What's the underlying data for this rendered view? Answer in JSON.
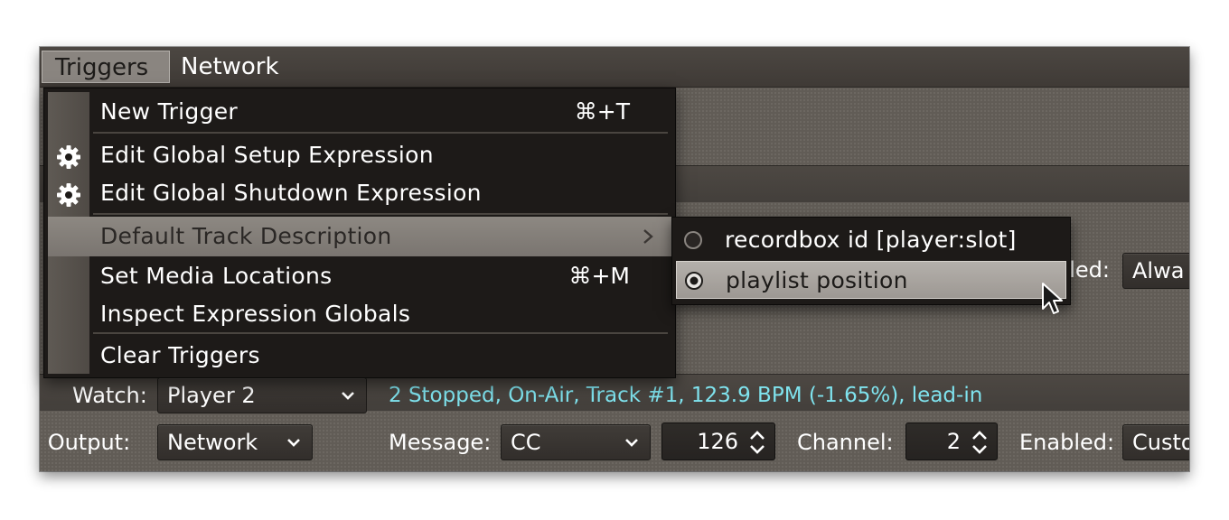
{
  "menubar": {
    "items": [
      {
        "label": "Triggers",
        "active": true
      },
      {
        "label": "Network",
        "active": false
      }
    ]
  },
  "triggers_menu": {
    "items": [
      {
        "label": "New Trigger",
        "shortcut": "⌘+T",
        "icon": ""
      },
      {
        "label": "Edit Global Setup Expression",
        "shortcut": "",
        "icon": "gear-icon"
      },
      {
        "label": "Edit Global Shutdown Expression",
        "shortcut": "",
        "icon": "gear-icon"
      },
      {
        "label": "Default Track Description",
        "shortcut": "",
        "icon": "",
        "submenu": true,
        "highlighted": true
      },
      {
        "label": "Set Media Locations",
        "shortcut": "⌘+M",
        "icon": ""
      },
      {
        "label": "Inspect Expression Globals",
        "shortcut": "",
        "icon": ""
      },
      {
        "label": "Clear Triggers",
        "shortcut": "",
        "icon": ""
      }
    ]
  },
  "default_track_submenu": {
    "items": [
      {
        "label": "recordbox id [player:slot]",
        "selected": false
      },
      {
        "label": "playlist position",
        "selected": true,
        "highlighted": true
      }
    ]
  },
  "trigger_row_partial": {
    "enabled_label_fragment": "bled:",
    "enabled_value_fragment": "Alwa"
  },
  "watch_row": {
    "watch_label": "Watch:",
    "watch_value": "Player 2",
    "status": "2 Stopped, On-Air, Track #1, 123.9 BPM (-1.65%), lead-in"
  },
  "output_row": {
    "output_label": "I Output:",
    "output_value": "Network",
    "message_label": "Message:",
    "message_value": "CC",
    "message_number": "126",
    "channel_label": "Channel:",
    "channel_value": "2",
    "enabled_label": "Enabled:",
    "enabled_value": "Custo"
  },
  "colors": {
    "status_text": "#7fe3ee",
    "menu_bg": "#1d1a18",
    "highlight": "#8d8882"
  }
}
